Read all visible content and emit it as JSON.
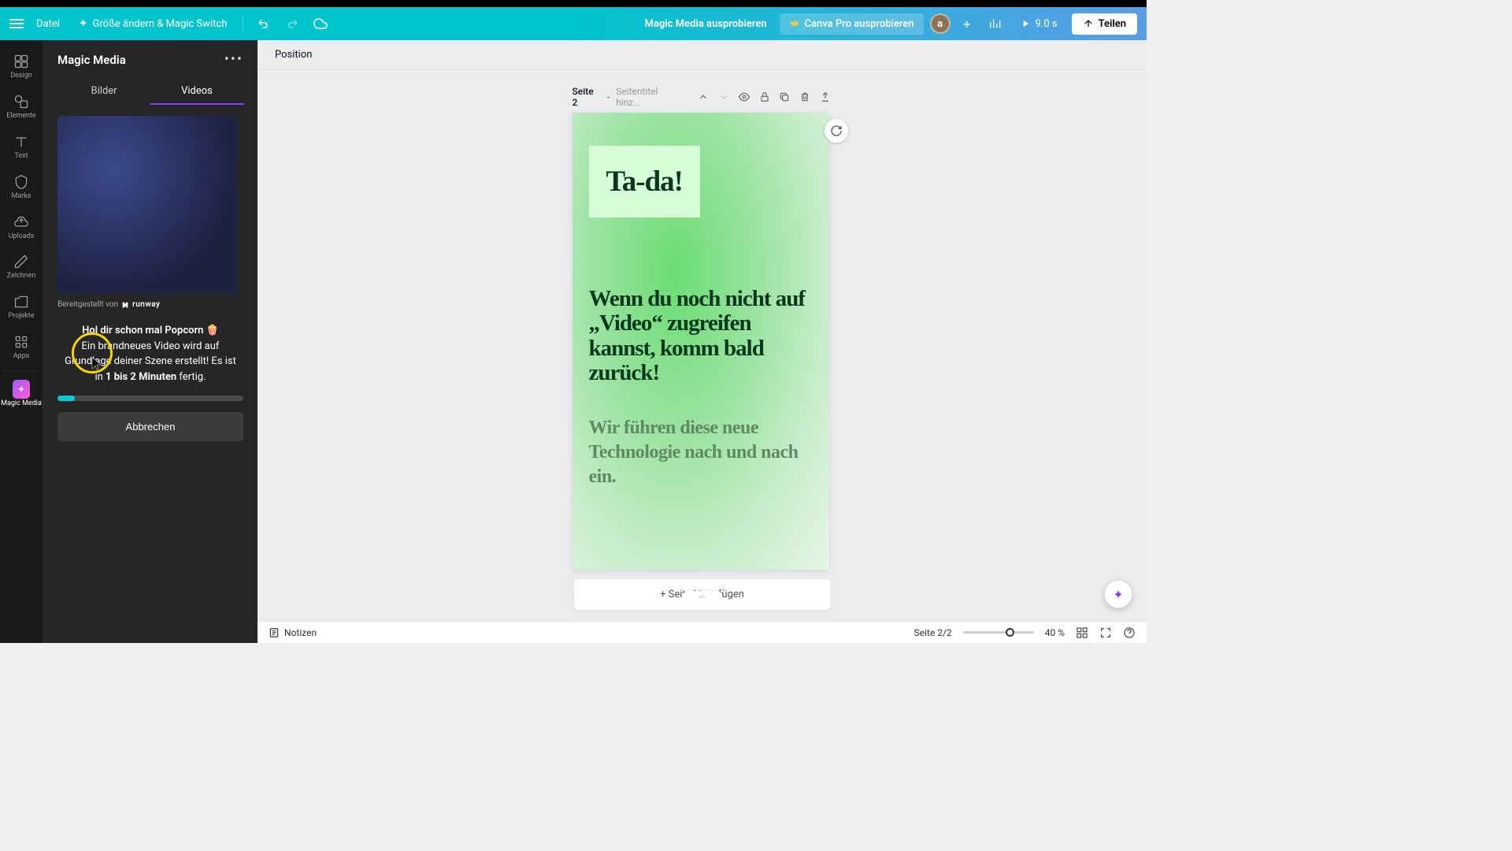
{
  "toolbar": {
    "file": "Datei",
    "resize": "Größe ändern & Magic Switch",
    "tryMagicMedia": "Magic Media ausprobieren",
    "tryPro": "Canva Pro ausprobieren",
    "avatar": "a",
    "duration": "9.0 s",
    "share": "Teilen"
  },
  "rail": {
    "design": "Design",
    "elements": "Elemente",
    "text": "Text",
    "brand": "Marke",
    "uploads": "Uploads",
    "draw": "Zeichnen",
    "projects": "Projekte",
    "apps": "Apps",
    "magic": "Magic Media"
  },
  "panel": {
    "title": "Magic Media",
    "tabImages": "Bilder",
    "tabVideos": "Videos",
    "provider": "Bereitgestellt von",
    "providerName": "runway",
    "genHeader": "Hol dir schon mal Popcorn 🍿",
    "genBody1": "Ein brandneues Video wird auf Grundlage deiner Szene erstellt! Es ist in ",
    "genBodyBold": "1 bis 2 Minuten",
    "genBody2": " fertig.",
    "cancel": "Abbrechen"
  },
  "context": {
    "position": "Position"
  },
  "page": {
    "number": "Seite 2",
    "titlePlaceholder": "Seitentitel hinz...",
    "tada": "Ta-da!",
    "body1": "Wenn du noch nicht auf „Video“ zugreifen kannst, komm bald zurück!",
    "body2": "Wir führen diese neue Technologie nach und nach ein.",
    "addPage": "+ Seite hinzufügen"
  },
  "bottom": {
    "notes": "Notizen",
    "pageIndicator": "Seite 2/2",
    "zoom": "40 %"
  }
}
